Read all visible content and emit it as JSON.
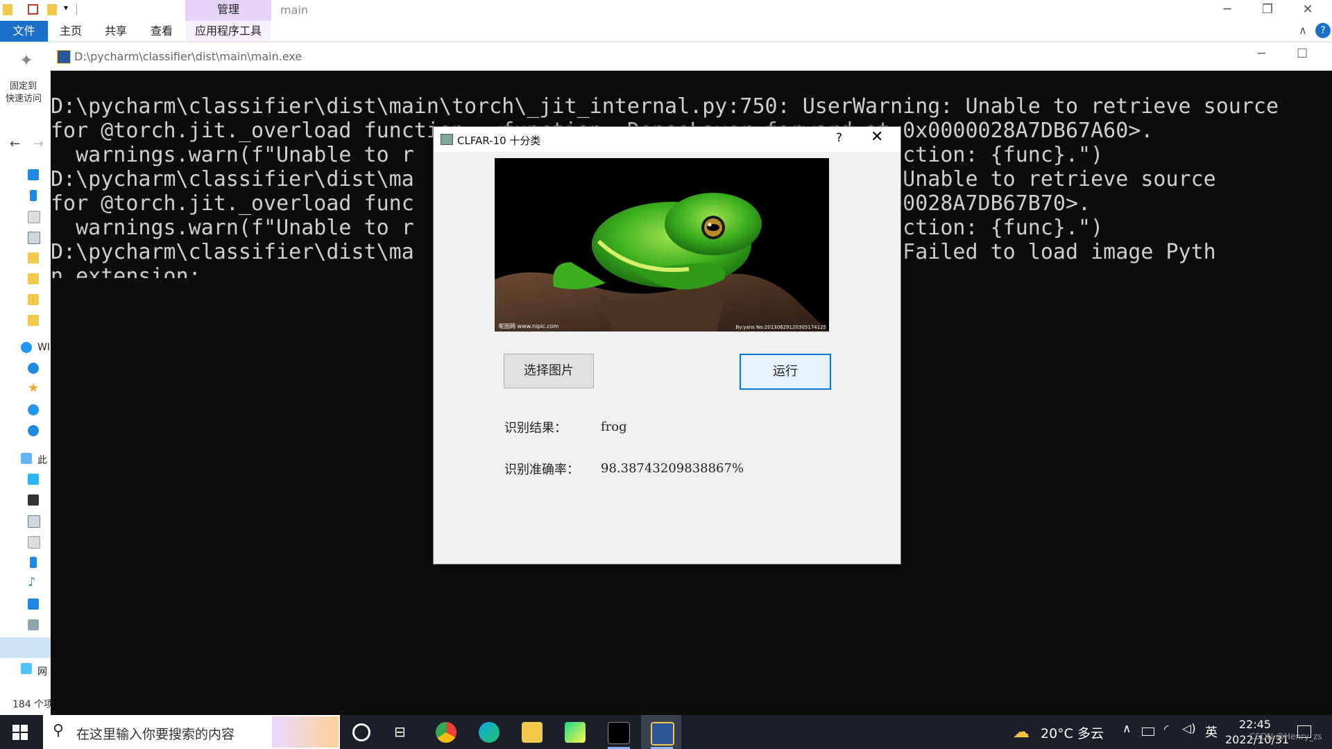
{
  "explorer": {
    "context_tab": "管理",
    "window_title": "main",
    "ribbon_tabs": [
      "文件",
      "主页",
      "共享",
      "查看",
      "应用程序工具"
    ],
    "pin_label_line1": "固定到",
    "pin_label_line2": "快速访问",
    "nav_fragments": [
      "WI",
      "此",
      "网"
    ],
    "item_count": "184 个项"
  },
  "console": {
    "title": "D:\\pycharm\\classifier\\dist\\main\\main.exe",
    "lines": [
      "D:\\pycharm\\classifier\\dist\\main\\torch\\_jit_internal.py:750: UserWarning: Unable to retrieve source",
      "for @torch.jit._overload function: <function _DenseLayer.forward at 0x0000028A7DB67A60>.",
      "  warnings.warn(f\"Unable to r                               load function: {func}.\")",
      "D:\\pycharm\\classifier\\dist\\ma                              Warning: Unable to retrieve source",
      "for @torch.jit._overload func                               at 0x0000028A7DB67B70>.",
      "  warnings.warn(f\"Unable to r                               load function: {func}.\")",
      "D:\\pycharm\\classifier\\dist\\ma                              Warning: Failed to load image Pyth",
      "n extension:"
    ]
  },
  "dialog": {
    "title": "CLFAR-10 十分类",
    "help": "?",
    "close": "✕",
    "select_button": "选择图片",
    "run_button": "运行",
    "result_label": "识别结果：",
    "result_value": "frog",
    "accuracy_label": "识别准确率：",
    "accuracy_value": "98.38743209838867%",
    "image_watermark_left": "昵图网 www.nipic.com",
    "image_watermark_right": "By:yans No:20130629120305174125"
  },
  "taskbar": {
    "search_placeholder": "在这里输入你要搜索的内容",
    "weather": "20°C 多云",
    "ime": "英",
    "time": "22:45",
    "date": "2022/10/31",
    "watermark": "CSDN @Henry_zs"
  },
  "colors": {
    "accent": "#1a6fc9",
    "console_bg": "#0c0c0c",
    "taskbar_bg": "#1b1f2a",
    "run_button_border": "#0078d7"
  }
}
